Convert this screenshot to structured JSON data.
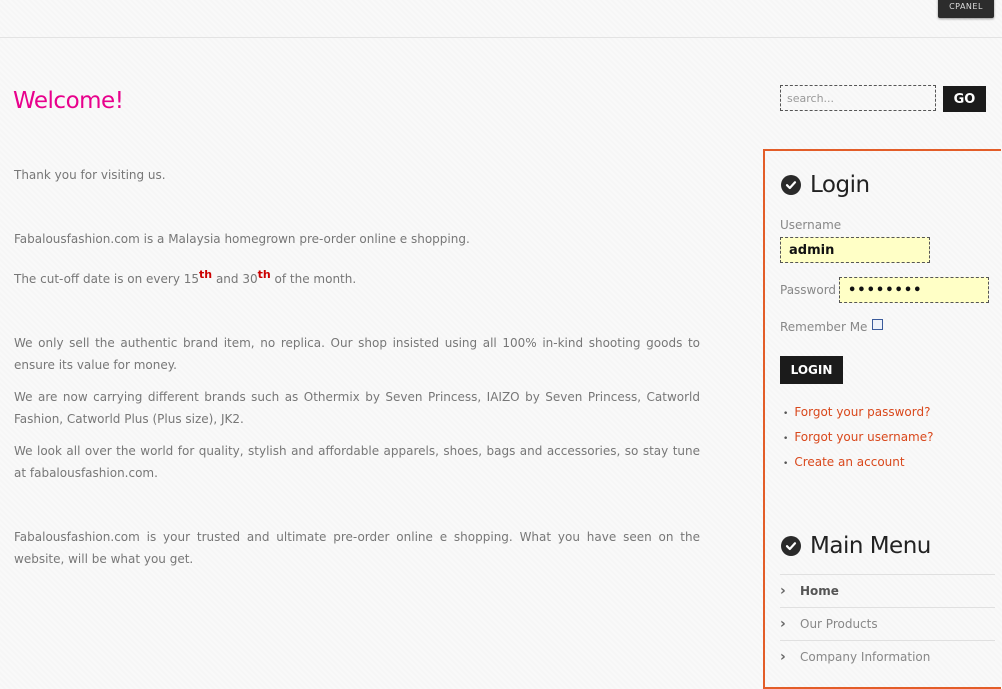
{
  "topbar": {
    "cpanel_label": "CPANEL"
  },
  "page": {
    "title": "Welcome!"
  },
  "content": {
    "p1": "Thank you for visiting us.",
    "p2": "Fabalousfashion.com is a Malaysia homegrown pre-order online e shopping.",
    "p3": {
      "prefix": "The cut-off date is on every 15",
      "sup1": "th",
      "middle": " and 30",
      "sup2": "th",
      "suffix": " of the month."
    },
    "p4": "We only sell the authentic brand item, no replica. Our shop insisted using all 100% in-kind shooting goods to ensure its value for money.",
    "p5": "We are now carrying different brands such as Othermix by Seven Princess, IAIZO by Seven Princess, Catworld Fashion, Catworld Plus (Plus size), JK2.",
    "p6": "We look all over the world for quality, stylish and affordable apparels, shoes, bags and accessories, so stay tune at fabalousfashion.com.",
    "p7": "Fabalousfashion.com is your trusted and ultimate pre-order online e shopping. What you have seen on the website, will be what you get."
  },
  "search": {
    "placeholder": "search...",
    "go_label": "GO"
  },
  "login": {
    "title": "Login",
    "username_label": "Username",
    "username_value": "admin",
    "password_label": "Password",
    "password_value": "12345678",
    "remember_label": "Remember Me",
    "button_label": "LOGIN",
    "links": [
      "Forgot your password?",
      "Forgot your username?",
      "Create an account"
    ]
  },
  "main_menu": {
    "title": "Main Menu",
    "items": [
      "Home",
      "Our Products",
      "Company Information"
    ]
  },
  "colors": {
    "title": "#e8008c",
    "accent_border": "#e35d28",
    "link": "#d9481c",
    "field_bg": "#ffffc6"
  },
  "icons": {
    "heading": "check-circle-icon",
    "menu_item": "chevron-right-icon"
  }
}
